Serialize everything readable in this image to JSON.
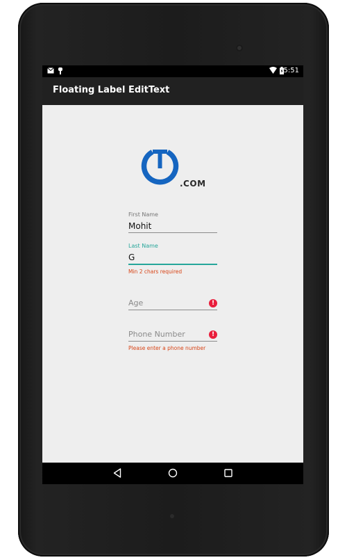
{
  "status_bar": {
    "time": "5:51",
    "icons": [
      "mail-icon",
      "android-debug-icon",
      "wifi-icon",
      "battery-icon"
    ]
  },
  "app_bar": {
    "title": "Floating Label EditText"
  },
  "logo": {
    "suffix": ".COM",
    "color": "#1565c0"
  },
  "form": {
    "first_name": {
      "label": "First Name",
      "value": "Mohit"
    },
    "last_name": {
      "label": "Last Name",
      "value": "G",
      "error": "Min 2 chars required"
    },
    "age": {
      "hint": "Age",
      "error_icon": "!"
    },
    "phone": {
      "hint": "Phone Number",
      "error_icon": "!",
      "error": "Please enter a phone number"
    }
  },
  "colors": {
    "accent": "#26a69a",
    "error": "#d84315",
    "error_icon": "#e91e3c",
    "app_bar": "#212121"
  },
  "nav_bar": {
    "buttons": [
      "back-icon",
      "home-icon",
      "recents-icon"
    ]
  }
}
